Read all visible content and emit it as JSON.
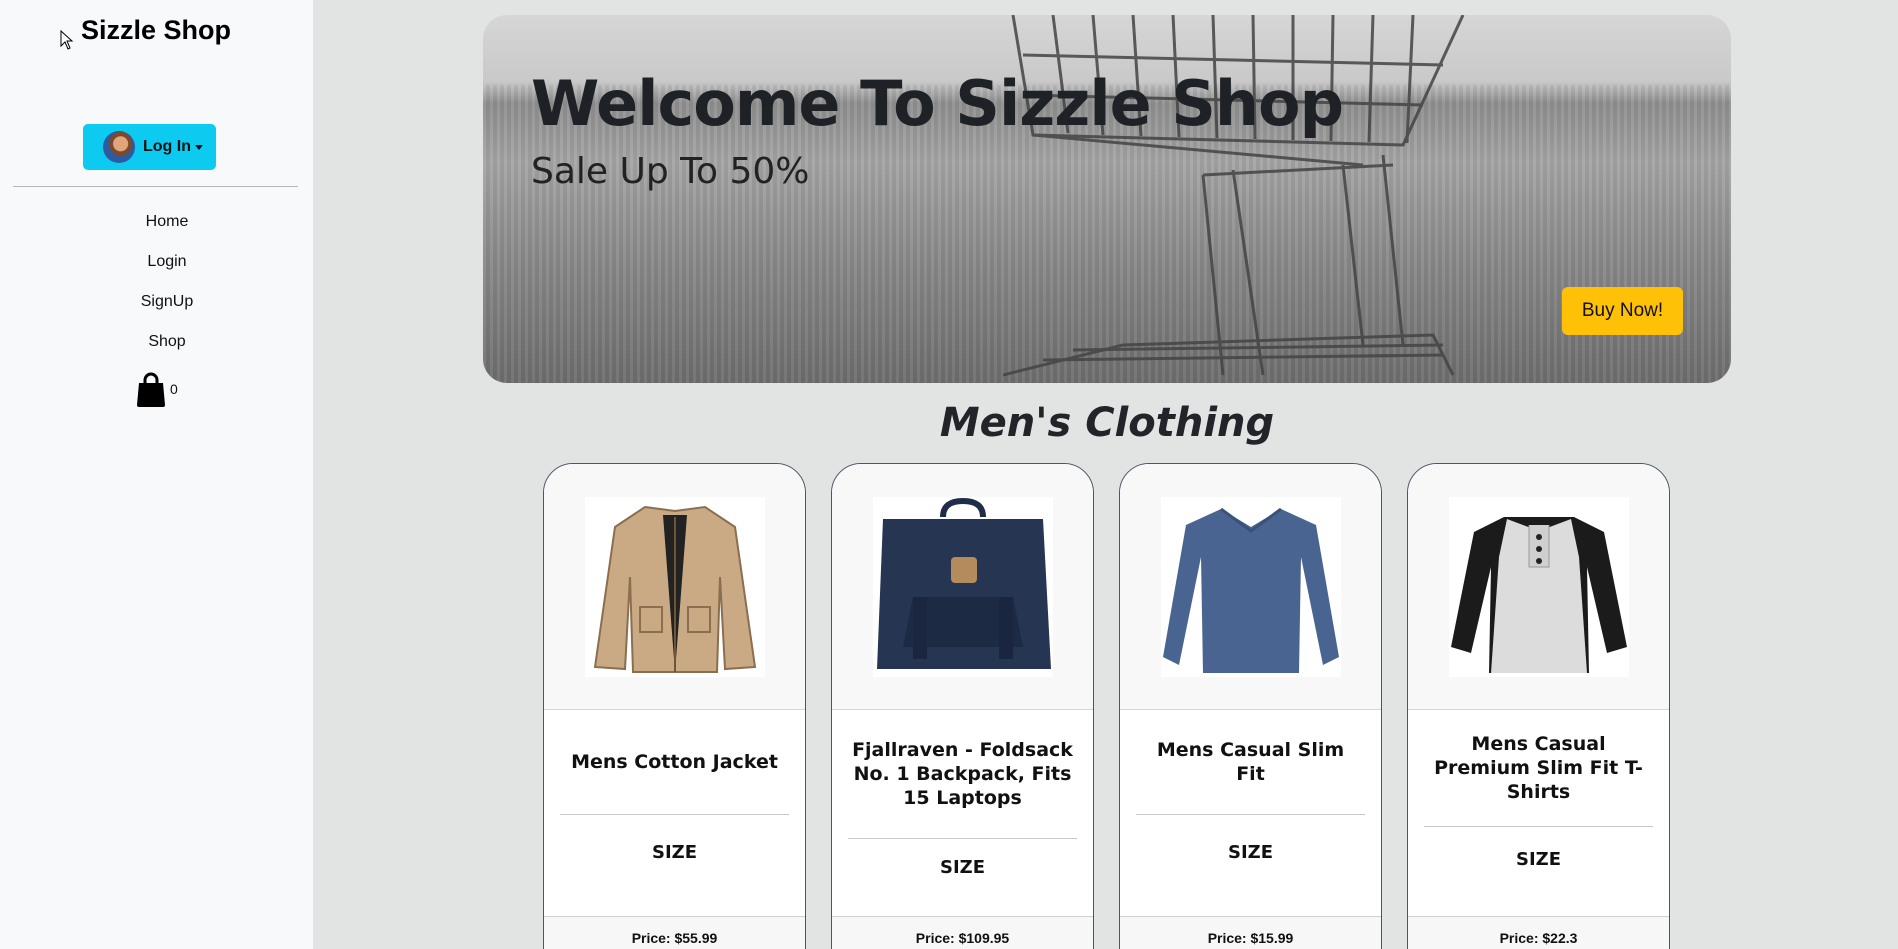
{
  "sidebar": {
    "brand": "Sizzle Shop",
    "login_label": "Log In",
    "nav": [
      "Home",
      "Login",
      "SignUp",
      "Shop"
    ],
    "cart_count": "0"
  },
  "hero": {
    "title": "Welcome To Sizzle Shop",
    "subtitle": "Sale Up To 50%",
    "button": "Buy Now!"
  },
  "section": {
    "title": "Men's Clothing"
  },
  "products": [
    {
      "title": "Mens Cotton Jacket",
      "size_label": "SIZE",
      "price": "Price: $55.99",
      "image": "jacket"
    },
    {
      "title": "Fjallraven - Foldsack No. 1 Backpack, Fits 15 Laptops",
      "size_label": "SIZE",
      "price": "Price: $109.95",
      "image": "backpack"
    },
    {
      "title": "Mens Casual Slim Fit",
      "size_label": "SIZE",
      "price": "Price: $15.99",
      "image": "longsleeve"
    },
    {
      "title": "Mens Casual Premium Slim Fit T-Shirts",
      "size_label": "SIZE",
      "price": "Price: $22.3",
      "image": "raglan"
    }
  ],
  "colors": {
    "accent": "#0dcaf0",
    "buy": "#ffc107",
    "sidebar_bg": "#f8f9fa",
    "page_bg": "#e2e3e3"
  }
}
